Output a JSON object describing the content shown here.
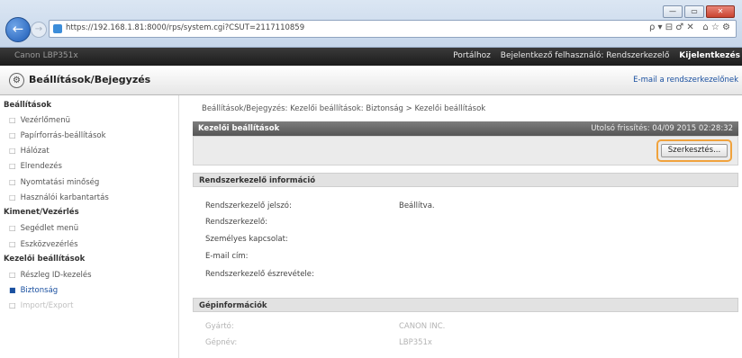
{
  "browser": {
    "url": "https://192.168.1.81:8000/rps/system.cgi?CSUT=2117110859",
    "tools": "ρ ▾ ⊟ ♂ ✕",
    "tab_icons": "⌂ ☆ ⚙",
    "window_buttons": [
      "—",
      "▭",
      "✕"
    ]
  },
  "topbar": {
    "device_name": "Canon LBP351x",
    "links": [
      "Portálhoz",
      "Bejelentkező felhasználó: Rendszerkezelő",
      "Kijelentkezés"
    ]
  },
  "header": {
    "title": "Beállítások/Bejegyzés",
    "mail_link": "E-mail a rendszerkezelőnek"
  },
  "sidebar": {
    "sections": [
      {
        "title": "Beállítások",
        "items": [
          {
            "label": "Vezérlőmenü",
            "state": "normal"
          },
          {
            "label": "Papírforrás-beállítások",
            "state": "normal"
          },
          {
            "label": "Hálózat",
            "state": "normal"
          },
          {
            "label": "Elrendezés",
            "state": "normal"
          },
          {
            "label": "Nyomtatási minőség",
            "state": "normal"
          },
          {
            "label": "Használói karbantartás",
            "state": "normal"
          }
        ]
      },
      {
        "title": "Kimenet/Vezérlés",
        "items": [
          {
            "label": "Segédlet menü",
            "state": "normal"
          },
          {
            "label": "Eszközvezérlés",
            "state": "normal"
          }
        ]
      },
      {
        "title": "Kezelői beállítások",
        "items": [
          {
            "label": "Részleg ID-kezelés",
            "state": "normal"
          },
          {
            "label": "Biztonság",
            "state": "active"
          },
          {
            "label": "Import/Export",
            "state": "faded"
          }
        ]
      }
    ]
  },
  "main": {
    "breadcrumb": "Beállítások/Bejegyzés: Kezelői beállítások: Biztonság > Kezelői beállítások",
    "panel_title": "Kezelői beállítások",
    "last_modified": "Utolsó frissítés: 04/09 2015 02:28:32",
    "edit_button": "Szerkesztés...",
    "admin_section": {
      "title": "Rendszerkezelő információ",
      "rows": [
        {
          "label": "Rendszerkezelő jelszó:",
          "value": "Beállítva."
        },
        {
          "label": "Rendszerkezelő:",
          "value": ""
        },
        {
          "label": "Személyes kapcsolat:",
          "value": ""
        },
        {
          "label": "E-mail cím:",
          "value": ""
        },
        {
          "label": "Rendszerkezelő észrevétele:",
          "value": ""
        }
      ]
    },
    "device_section": {
      "title": "Gépinformációk",
      "rows": [
        {
          "label": "Gyártó:",
          "value": "CANON INC."
        },
        {
          "label": "Gépnév:",
          "value": "LBP351x"
        }
      ]
    }
  },
  "colors": {
    "highlight_ring": "#f0a23c",
    "link_blue": "#1a50a0",
    "panel_head": "#666666"
  }
}
